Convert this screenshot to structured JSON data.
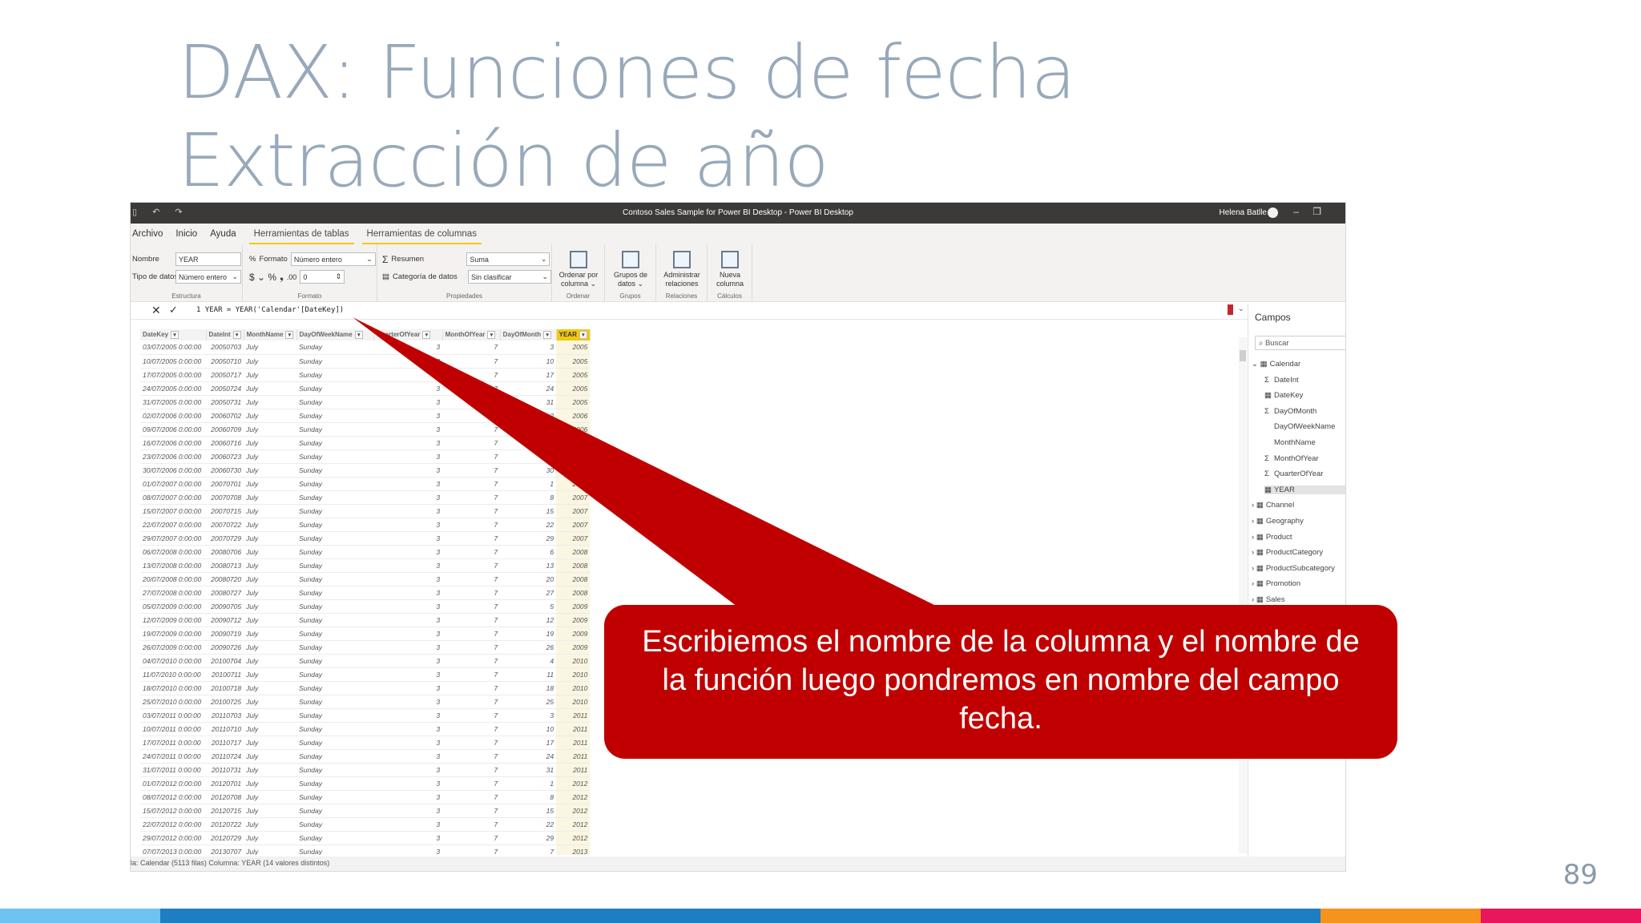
{
  "slide": {
    "title_line1": "DAX: Funciones de fecha",
    "title_line2": "Extracción de año",
    "page_number": "89",
    "callout_text": "Escribiemos el nombre de la columna y el nombre de la función luego pondremos en nombre del campo fecha.",
    "colors": {
      "title": "#97a9ba",
      "callout": "#c00000",
      "bar": [
        "#6fc3f1",
        "#1d7ec2",
        "#f6921e",
        "#e8175d"
      ]
    }
  },
  "window": {
    "title": "Contoso Sales Sample for Power BI Desktop - Power BI Desktop",
    "user": "Helena Batlle",
    "quick_access": "▯ ↶ ↷",
    "minimize": "–",
    "restore": "❐"
  },
  "menu": {
    "archivo": "Archivo",
    "inicio": "Inicio",
    "ayuda": "Ayuda",
    "herr_tablas": "Herramientas de tablas",
    "herr_columnas": "Herramientas de columnas"
  },
  "ribbon": {
    "nombre_label": "Nombre",
    "nombre_value": "YEAR",
    "tipo_label": "Tipo de datos",
    "tipo_value": "Número entero",
    "estructura": "Estructura",
    "formato_label": "Formato",
    "formato_value": "Número entero",
    "currency": "$ ⌄ %",
    "comma": "❟",
    "decimals": ".00",
    "decimal_value": "0",
    "formato_group": "Formato",
    "resumen_label": "Resumen",
    "resumen_value": "Suma",
    "categoria_label": "Categoría de datos",
    "categoria_value": "Sin clasificar",
    "propiedades": "Propiedades",
    "ordenar": "Ordenar por columna ⌄",
    "ordenar_group": "Ordenar",
    "grupos": "Grupos de datos ⌄",
    "grupos_group": "Grupos",
    "administrar": "Administrar relaciones",
    "relaciones_group": "Relaciones",
    "nueva": "Nueva columna",
    "calculos_group": "Cálculos"
  },
  "formula": {
    "text": "1  YEAR = YEAR('Calendar'[DateKey])"
  },
  "table": {
    "columns": [
      "DateKey",
      "DateInt",
      "MonthName",
      "DayOfWeekName",
      "QuarterOfYear",
      "MonthOfYear",
      "DayOfMonth",
      "YEAR"
    ],
    "rows": [
      [
        "03/07/2005 0:00:00",
        "20050703",
        "July",
        "Sunday",
        "3",
        "7",
        "3",
        "2005"
      ],
      [
        "10/07/2005 0:00:00",
        "20050710",
        "July",
        "Sunday",
        "3",
        "7",
        "10",
        "2005"
      ],
      [
        "17/07/2005 0:00:00",
        "20050717",
        "July",
        "Sunday",
        "3",
        "7",
        "17",
        "2005"
      ],
      [
        "24/07/2005 0:00:00",
        "20050724",
        "July",
        "Sunday",
        "3",
        "7",
        "24",
        "2005"
      ],
      [
        "31/07/2005 0:00:00",
        "20050731",
        "July",
        "Sunday",
        "3",
        "7",
        "31",
        "2005"
      ],
      [
        "02/07/2006 0:00:00",
        "20060702",
        "July",
        "Sunday",
        "3",
        "7",
        "2",
        "2006"
      ],
      [
        "09/07/2006 0:00:00",
        "20060709",
        "July",
        "Sunday",
        "3",
        "7",
        "9",
        "2006"
      ],
      [
        "16/07/2006 0:00:00",
        "20060716",
        "July",
        "Sunday",
        "3",
        "7",
        "16",
        "2006"
      ],
      [
        "23/07/2006 0:00:00",
        "20060723",
        "July",
        "Sunday",
        "3",
        "7",
        "23",
        "2006"
      ],
      [
        "30/07/2006 0:00:00",
        "20060730",
        "July",
        "Sunday",
        "3",
        "7",
        "30",
        "2006"
      ],
      [
        "01/07/2007 0:00:00",
        "20070701",
        "July",
        "Sunday",
        "3",
        "7",
        "1",
        "2007"
      ],
      [
        "08/07/2007 0:00:00",
        "20070708",
        "July",
        "Sunday",
        "3",
        "7",
        "8",
        "2007"
      ],
      [
        "15/07/2007 0:00:00",
        "20070715",
        "July",
        "Sunday",
        "3",
        "7",
        "15",
        "2007"
      ],
      [
        "22/07/2007 0:00:00",
        "20070722",
        "July",
        "Sunday",
        "3",
        "7",
        "22",
        "2007"
      ],
      [
        "29/07/2007 0:00:00",
        "20070729",
        "July",
        "Sunday",
        "3",
        "7",
        "29",
        "2007"
      ],
      [
        "06/07/2008 0:00:00",
        "20080706",
        "July",
        "Sunday",
        "3",
        "7",
        "6",
        "2008"
      ],
      [
        "13/07/2008 0:00:00",
        "20080713",
        "July",
        "Sunday",
        "3",
        "7",
        "13",
        "2008"
      ],
      [
        "20/07/2008 0:00:00",
        "20080720",
        "July",
        "Sunday",
        "3",
        "7",
        "20",
        "2008"
      ],
      [
        "27/07/2008 0:00:00",
        "20080727",
        "July",
        "Sunday",
        "3",
        "7",
        "27",
        "2008"
      ],
      [
        "05/07/2009 0:00:00",
        "20090705",
        "July",
        "Sunday",
        "3",
        "7",
        "5",
        "2009"
      ],
      [
        "12/07/2009 0:00:00",
        "20090712",
        "July",
        "Sunday",
        "3",
        "7",
        "12",
        "2009"
      ],
      [
        "19/07/2009 0:00:00",
        "20090719",
        "July",
        "Sunday",
        "3",
        "7",
        "19",
        "2009"
      ],
      [
        "26/07/2009 0:00:00",
        "20090726",
        "July",
        "Sunday",
        "3",
        "7",
        "26",
        "2009"
      ],
      [
        "04/07/2010 0:00:00",
        "20100704",
        "July",
        "Sunday",
        "3",
        "7",
        "4",
        "2010"
      ],
      [
        "11/07/2010 0:00:00",
        "20100711",
        "July",
        "Sunday",
        "3",
        "7",
        "11",
        "2010"
      ],
      [
        "18/07/2010 0:00:00",
        "20100718",
        "July",
        "Sunday",
        "3",
        "7",
        "18",
        "2010"
      ],
      [
        "25/07/2010 0:00:00",
        "20100725",
        "July",
        "Sunday",
        "3",
        "7",
        "25",
        "2010"
      ],
      [
        "03/07/2011 0:00:00",
        "20110703",
        "July",
        "Sunday",
        "3",
        "7",
        "3",
        "2011"
      ],
      [
        "10/07/2011 0:00:00",
        "20110710",
        "July",
        "Sunday",
        "3",
        "7",
        "10",
        "2011"
      ],
      [
        "17/07/2011 0:00:00",
        "20110717",
        "July",
        "Sunday",
        "3",
        "7",
        "17",
        "2011"
      ],
      [
        "24/07/2011 0:00:00",
        "20110724",
        "July",
        "Sunday",
        "3",
        "7",
        "24",
        "2011"
      ],
      [
        "31/07/2011 0:00:00",
        "20110731",
        "July",
        "Sunday",
        "3",
        "7",
        "31",
        "2011"
      ],
      [
        "01/07/2012 0:00:00",
        "20120701",
        "July",
        "Sunday",
        "3",
        "7",
        "1",
        "2012"
      ],
      [
        "08/07/2012 0:00:00",
        "20120708",
        "July",
        "Sunday",
        "3",
        "7",
        "8",
        "2012"
      ],
      [
        "15/07/2012 0:00:00",
        "20120715",
        "July",
        "Sunday",
        "3",
        "7",
        "15",
        "2012"
      ],
      [
        "22/07/2012 0:00:00",
        "20120722",
        "July",
        "Sunday",
        "3",
        "7",
        "22",
        "2012"
      ],
      [
        "29/07/2012 0:00:00",
        "20120729",
        "July",
        "Sunday",
        "3",
        "7",
        "29",
        "2012"
      ],
      [
        "07/07/2013 0:00:00",
        "20130707",
        "July",
        "Sunday",
        "3",
        "7",
        "7",
        "2013"
      ]
    ]
  },
  "fields": {
    "title": "Campos",
    "search_placeholder": "Buscar",
    "items": [
      {
        "label": "Calendar",
        "kind": "table-open"
      },
      {
        "label": "DateInt",
        "kind": "sigma"
      },
      {
        "label": "DateKey",
        "kind": "date"
      },
      {
        "label": "DayOfMonth",
        "kind": "sigma"
      },
      {
        "label": "DayOfWeekName",
        "kind": "text"
      },
      {
        "label": "MonthName",
        "kind": "text"
      },
      {
        "label": "MonthOfYear",
        "kind": "sigma"
      },
      {
        "label": "QuarterOfYear",
        "kind": "sigma"
      },
      {
        "label": "YEAR",
        "kind": "calc",
        "selected": true
      },
      {
        "label": "Channel",
        "kind": "table"
      },
      {
        "label": "Geography",
        "kind": "table"
      },
      {
        "label": "Product",
        "kind": "table"
      },
      {
        "label": "ProductCategory",
        "kind": "table"
      },
      {
        "label": "ProductSubcategory",
        "kind": "table"
      },
      {
        "label": "Promotion",
        "kind": "table"
      },
      {
        "label": "Sales",
        "kind": "table"
      }
    ]
  },
  "status": {
    "text": "la: Calendar (5113 filas) Columna: YEAR (14 valores distintos)"
  }
}
